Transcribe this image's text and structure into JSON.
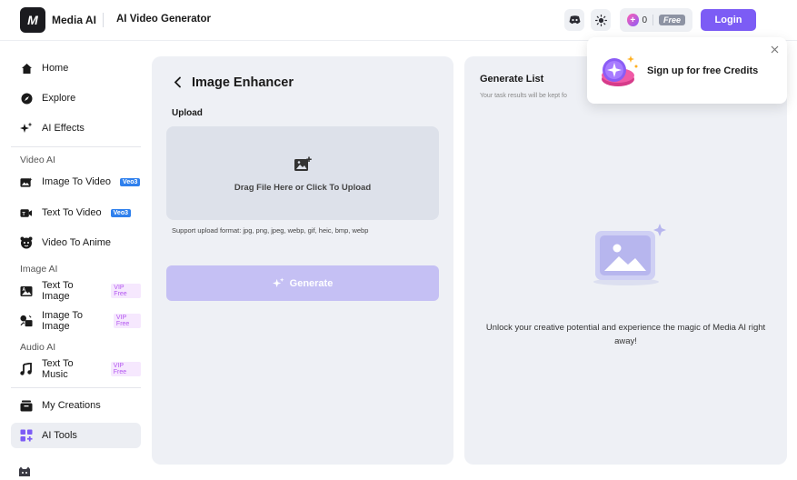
{
  "header": {
    "logo_text": "M",
    "brand": "Media AI",
    "subtitle": "AI Video Generator",
    "credits_count": "0",
    "credits_badge": "Free",
    "login_label": "Login"
  },
  "sidebar": {
    "home": "Home",
    "explore": "Explore",
    "ai_effects": "AI Effects",
    "section_video": "Video AI",
    "image_to_video": "Image To Video",
    "image_to_video_badge": "Veo3",
    "text_to_video": "Text To Video",
    "text_to_video_badge": "Veo3",
    "video_to_anime": "Video To Anime",
    "section_image": "Image AI",
    "text_to_image": "Text To Image",
    "text_to_image_badge": "VIP Free",
    "image_to_image": "Image To Image",
    "image_to_image_badge": "VIP Free",
    "section_audio": "Audio AI",
    "text_to_music": "Text To Music",
    "text_to_music_badge": "VIP Free",
    "my_creations": "My Creations",
    "ai_tools": "AI Tools"
  },
  "enhancer": {
    "title": "Image Enhancer",
    "upload_label": "Upload",
    "drop_text": "Drag File Here or Click To Upload",
    "support_text": "Support upload format: jpg, png, jpeg, webp, gif, heic, bmp, webp",
    "generate_label": "Generate"
  },
  "generate_list": {
    "title": "Generate List",
    "subtitle": "Your task results will be kept fo",
    "empty_text": "Unlock your creative potential and experience the magic of Media AI right away!"
  },
  "popup": {
    "text": "Sign up for free Credits"
  },
  "colors": {
    "accent": "#7c5cf5",
    "generate_disabled": "#c5c0f4",
    "card_bg": "#eef0f5"
  }
}
